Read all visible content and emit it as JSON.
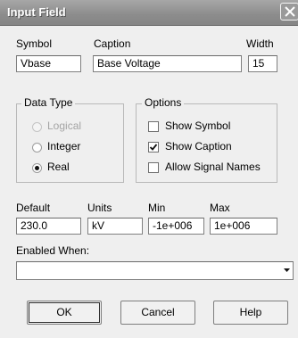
{
  "window": {
    "title": "Input Field"
  },
  "fields": {
    "symbol": {
      "label": "Symbol",
      "value": "Vbase"
    },
    "caption": {
      "label": "Caption",
      "value": "Base Voltage"
    },
    "width": {
      "label": "Width",
      "value": "15"
    }
  },
  "data_type": {
    "legend": "Data Type",
    "options": [
      {
        "label": "Logical",
        "selected": false,
        "enabled": false
      },
      {
        "label": "Integer",
        "selected": false,
        "enabled": true
      },
      {
        "label": "Real",
        "selected": true,
        "enabled": true
      }
    ]
  },
  "options_group": {
    "legend": "Options",
    "checkboxes": [
      {
        "label": "Show Symbol",
        "checked": false
      },
      {
        "label": "Show Caption",
        "checked": true
      },
      {
        "label": "Allow Signal Names",
        "checked": false
      }
    ]
  },
  "values": {
    "default": {
      "label": "Default",
      "value": "230.0"
    },
    "units": {
      "label": "Units",
      "value": "kV"
    },
    "min": {
      "label": "Min",
      "value": "-1e+006"
    },
    "max": {
      "label": "Max",
      "value": "1e+006"
    }
  },
  "enabled_when": {
    "label": "Enabled When:",
    "value": ""
  },
  "buttons": {
    "ok": "OK",
    "cancel": "Cancel",
    "help": "Help"
  }
}
